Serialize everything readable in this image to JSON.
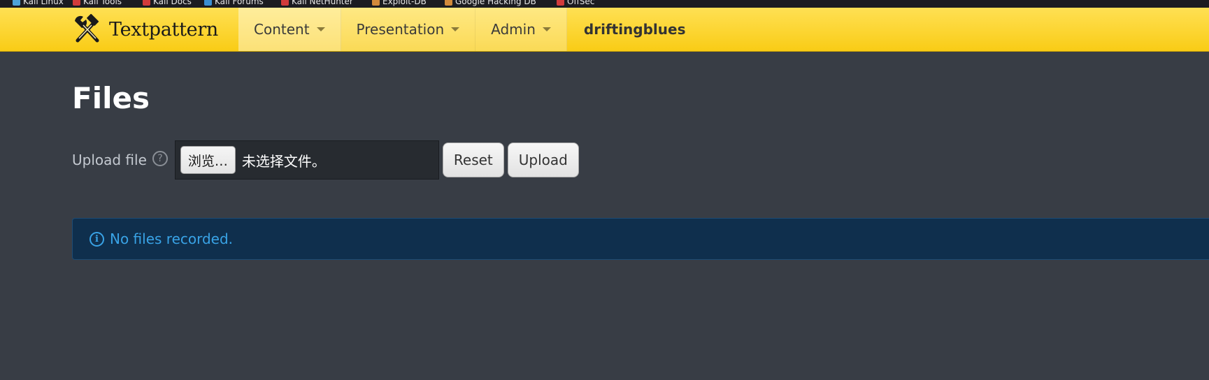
{
  "bookmarks": [
    {
      "label": "Kali Linux",
      "icon": "kali-icon",
      "color": "#4da3d8"
    },
    {
      "label": "Kali Tools",
      "icon": "kali-tools-icon",
      "color": "#d23b3b"
    },
    {
      "label": "Kali Docs",
      "icon": "kali-docs-icon",
      "color": "#d23b3b"
    },
    {
      "label": "Kali Forums",
      "icon": "kali-forums-icon",
      "color": "#3b8fd2"
    },
    {
      "label": "Kali NetHunter",
      "icon": "nethunter-icon",
      "color": "#d23b3b"
    },
    {
      "label": "Exploit-DB",
      "icon": "exploit-db-icon",
      "color": "#d28a3b"
    },
    {
      "label": "Google Hacking DB",
      "icon": "ghdb-icon",
      "color": "#d28a3b"
    },
    {
      "label": "OffSec",
      "icon": "offsec-icon",
      "color": "#d23b3b"
    }
  ],
  "header": {
    "brand": "Textpattern",
    "nav": [
      {
        "label": "Content"
      },
      {
        "label": "Presentation"
      },
      {
        "label": "Admin"
      }
    ],
    "site_name": "driftingblues"
  },
  "page": {
    "title": "Files"
  },
  "upload": {
    "label": "Upload file",
    "help_icon": "question-circle-icon",
    "browse_label": "浏览…",
    "file_status": "未选择文件。",
    "reset_label": "Reset",
    "upload_label": "Upload"
  },
  "notice": {
    "icon": "info-icon",
    "text": "No files recorded."
  },
  "colors": {
    "background": "#383d45",
    "header": "#f9cc16",
    "notice_bg": "#0f2f4d",
    "notice_text": "#39a3e6"
  }
}
